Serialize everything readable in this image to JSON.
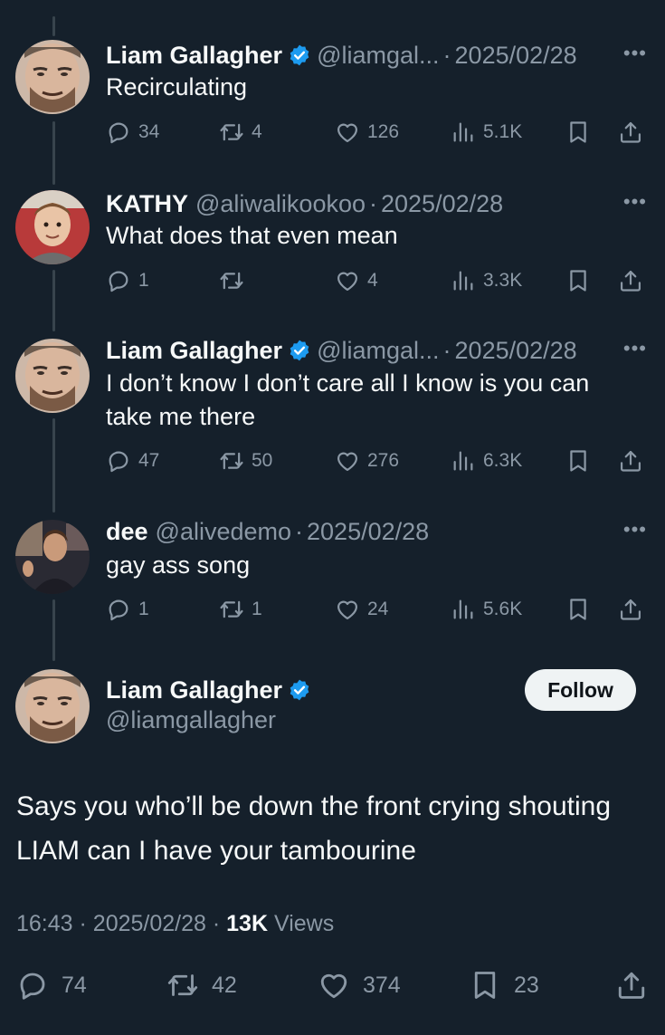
{
  "replies": [
    {
      "name": "Liam Gallagher",
      "verified": true,
      "handle": "@liamgal...",
      "date": "2025/02/28",
      "text": "Recirculating",
      "replies": "34",
      "reposts": "4",
      "likes": "126",
      "views": "5.1K"
    },
    {
      "name": "KATHY",
      "verified": false,
      "handle": "@aliwalikookoo",
      "date": "2025/02/28",
      "text": "What does that even mean",
      "replies": "1",
      "reposts": "",
      "likes": "4",
      "views": "3.3K"
    },
    {
      "name": "Liam Gallagher",
      "verified": true,
      "handle": "@liamgal...",
      "date": "2025/02/28",
      "text": "I don’t know I don’t care all I know is you can take me there",
      "replies": "47",
      "reposts": "50",
      "likes": "276",
      "views": "6.3K"
    },
    {
      "name": "dee",
      "verified": false,
      "handle": "@alivedemo",
      "date": "2025/02/28",
      "text": "gay ass song",
      "replies": "1",
      "reposts": "1",
      "likes": "24",
      "views": "5.6K"
    }
  ],
  "main": {
    "name": "Liam Gallagher",
    "handle": "@liamgallagher",
    "follow_label": "Follow",
    "text": "Says you who’ll be down the front crying shouting LIAM can I have your tambourine",
    "time": "16:43",
    "date": "2025/02/28",
    "views_count": "13K",
    "views_label": "Views",
    "replies": "74",
    "reposts": "42",
    "likes": "374",
    "bookmarks": "23"
  },
  "ui": {
    "dot": "·",
    "more": "•••"
  },
  "colors": {
    "background": "#15202b",
    "muted": "#8b98a5",
    "verified": "#1d9bf0",
    "thread_line": "#38444d"
  }
}
